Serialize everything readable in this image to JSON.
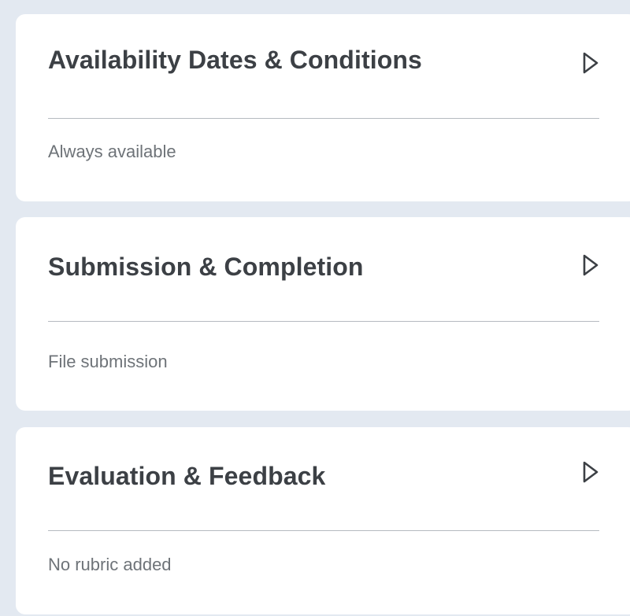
{
  "panels": [
    {
      "title": "Availability Dates & Conditions",
      "summary": "Always available",
      "icon": "chevron-right-icon"
    },
    {
      "title": "Submission & Completion",
      "summary": "File submission",
      "icon": "chevron-right-icon"
    },
    {
      "title": "Evaluation & Feedback",
      "summary": "No rubric added",
      "icon": "chevron-right-icon"
    }
  ],
  "colors": {
    "background": "#e3e9f1",
    "panel": "#ffffff",
    "title": "#3c4045",
    "summary": "#6e7378",
    "divider": "#b5bac0"
  }
}
